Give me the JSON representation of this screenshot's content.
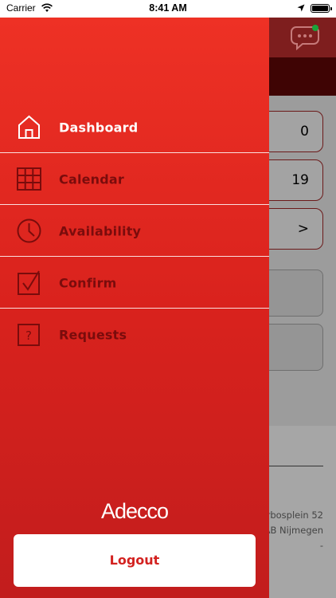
{
  "status_bar": {
    "carrier": "Carrier",
    "time": "8:41 AM"
  },
  "background": {
    "cards": [
      {
        "value": "0"
      },
      {
        "value": "19"
      },
      {
        "value": ">"
      }
    ],
    "address_lines": [
      "erbosplein 52",
      "AB Nijmegen",
      "-"
    ],
    "header_color": "#7e1e1e",
    "notification_dot_color": "#1aa33a"
  },
  "drawer": {
    "menu": [
      {
        "label": "Dashboard",
        "icon": "home-icon",
        "active": true
      },
      {
        "label": "Calendar",
        "icon": "calendar-grid-icon",
        "active": false
      },
      {
        "label": "Availability",
        "icon": "clock-icon",
        "active": false
      },
      {
        "label": "Confirm",
        "icon": "checkbox-check-icon",
        "active": false
      },
      {
        "label": "Requests",
        "icon": "question-box-icon",
        "active": false
      }
    ],
    "brand": "Adecco",
    "logout_label": "Logout",
    "accent_color": "#e32b22",
    "inactive_color": "#7a0c0c"
  }
}
